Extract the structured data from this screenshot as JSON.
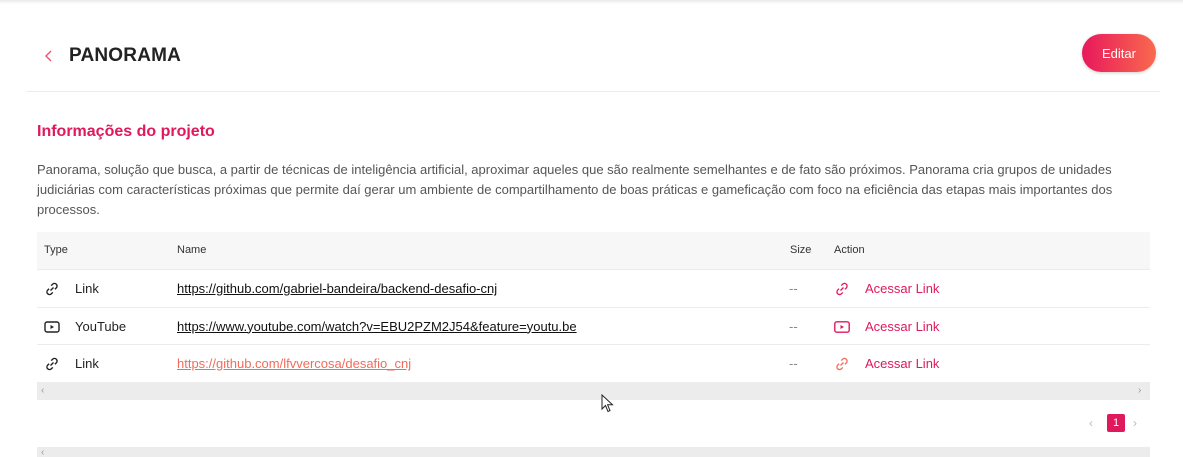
{
  "header": {
    "title": "PANORAMA",
    "edit_label": "Editar"
  },
  "project": {
    "section_title": "Informações do projeto",
    "description": "Panorama, solução que busca, a partir de técnicas de inteligência artificial, aproximar aqueles que são realmente semelhantes e de fato são próximos. Panorama cria grupos de unidades judiciárias com características próximas que permite daí gerar um ambiente de compartilhamento de boas práticas e gameficação com foco na eficiência das etapas mais importantes dos processos."
  },
  "table": {
    "columns": [
      "Type",
      "Name",
      "Size",
      "Action"
    ],
    "rows": [
      {
        "type": "Link",
        "type_icon": "link-icon",
        "name": "https://github.com/gabriel-bandeira/backend-desafio-cnj",
        "size": "--",
        "action": "Acessar Link"
      },
      {
        "type": "YouTube",
        "type_icon": "youtube-icon",
        "name": "https://www.youtube.com/watch?v=EBU2PZM2J54&feature=youtu.be",
        "size": "--",
        "action": "Acessar Link"
      },
      {
        "type": "Link",
        "type_icon": "link-icon",
        "name": "https://github.com/lfvvercosa/desafio_cnj",
        "size": "--",
        "action": "Acessar Link"
      }
    ]
  },
  "pagination": {
    "current_page": "1"
  },
  "colors": {
    "accent": "#e0185c",
    "gradient_end": "#f96a4e",
    "visited_link": "#f26b5a"
  }
}
